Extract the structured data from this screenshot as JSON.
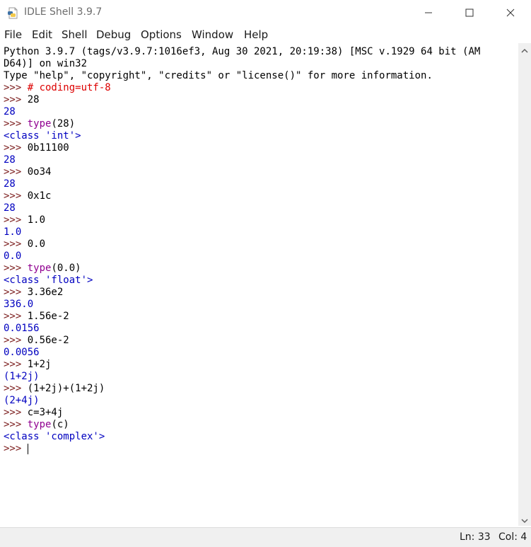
{
  "window": {
    "title": "IDLE Shell 3.9.7",
    "icon": "python-file-icon"
  },
  "menu": {
    "items": [
      "File",
      "Edit",
      "Shell",
      "Debug",
      "Options",
      "Window",
      "Help"
    ]
  },
  "shell": {
    "banner": [
      "Python 3.9.7 (tags/v3.9.7:1016ef3, Aug 30 2021, 20:19:38) [MSC v.1929 64 bit (AM",
      "D64)] on win32",
      "Type \"help\", \"copyright\", \"credits\" or \"license()\" for more information."
    ],
    "prompt": ">>> ",
    "lines": [
      {
        "kind": "input",
        "text": "# coding=utf-8"
      },
      {
        "kind": "input",
        "text": "28"
      },
      {
        "kind": "output",
        "text": "28"
      },
      {
        "kind": "input",
        "text": "type(28)"
      },
      {
        "kind": "output",
        "text": "<class 'int'>"
      },
      {
        "kind": "input",
        "text": "0b11100"
      },
      {
        "kind": "output",
        "text": "28"
      },
      {
        "kind": "input",
        "text": "0o34"
      },
      {
        "kind": "output",
        "text": "28"
      },
      {
        "kind": "input",
        "text": "0x1c"
      },
      {
        "kind": "output",
        "text": "28"
      },
      {
        "kind": "input",
        "text": "1.0"
      },
      {
        "kind": "output",
        "text": "1.0"
      },
      {
        "kind": "input",
        "text": "0.0"
      },
      {
        "kind": "output",
        "text": "0.0"
      },
      {
        "kind": "input",
        "text": "type(0.0)"
      },
      {
        "kind": "output",
        "text": "<class 'float'>"
      },
      {
        "kind": "input",
        "text": "3.36e2"
      },
      {
        "kind": "output",
        "text": "336.0"
      },
      {
        "kind": "input",
        "text": "1.56e-2"
      },
      {
        "kind": "output",
        "text": "0.0156"
      },
      {
        "kind": "input",
        "text": "0.56e-2"
      },
      {
        "kind": "output",
        "text": "0.0056"
      },
      {
        "kind": "input",
        "text": "1+2j"
      },
      {
        "kind": "output",
        "text": "(1+2j)"
      },
      {
        "kind": "input",
        "text": "(1+2j)+(1+2j)"
      },
      {
        "kind": "output",
        "text": "(2+4j)"
      },
      {
        "kind": "input",
        "text": "c=3+4j"
      },
      {
        "kind": "input",
        "text": "type(c)"
      },
      {
        "kind": "output",
        "text": "<class 'complex'>"
      },
      {
        "kind": "input",
        "text": ""
      }
    ]
  },
  "status": {
    "line": "Ln: 33",
    "col": "Col: 4"
  },
  "colors": {
    "prompt": "#7a1a1a",
    "output": "#0000c0",
    "comment": "#dd0000",
    "builtin": "#900090"
  }
}
